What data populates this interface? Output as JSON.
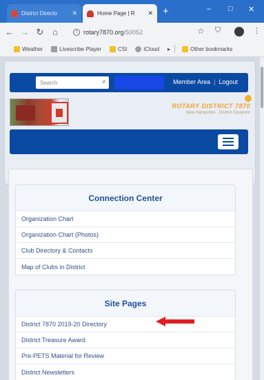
{
  "browser": {
    "tabs": [
      {
        "label": "District Directo",
        "active": false
      },
      {
        "label": "Home Page | R",
        "active": true
      }
    ],
    "new_tab_glyph": "+",
    "window": {
      "minimize": "–",
      "maximize": "□",
      "close": "✕"
    },
    "address": {
      "domain": "rotary7870.org",
      "path": "/50052"
    },
    "bookmarks": [
      {
        "label": "Weather",
        "icon": "folder"
      },
      {
        "label": "Livescribe Player",
        "icon": "app"
      },
      {
        "label": "CSI",
        "icon": "folder"
      },
      {
        "label": "iCloud",
        "icon": "apple"
      },
      {
        "label": "Other bookmarks",
        "icon": "folder"
      }
    ]
  },
  "site": {
    "search": {
      "placeholder": "Search"
    },
    "top_links": {
      "member_area": "Member Area",
      "logout": "Logout"
    },
    "brand": {
      "title": "ROTARY DISTRICT 7870",
      "subtitle": "New Hampshire · District Governor"
    },
    "accent_colors": {
      "primary": "#0b4aa3",
      "brand_orange": "#f2a030",
      "arrow_red": "#e02020"
    }
  },
  "sections": [
    {
      "title": "Connection Center",
      "items": [
        "Organization Chart",
        "Organization Chart (Photos)",
        "Club Directory & Contacts",
        "Map of Clubs in District"
      ]
    },
    {
      "title": "Site Pages",
      "items": [
        "District 7870 2019-20 Directory",
        "District Treasure Award",
        "Pre-PETS Material for Review",
        "District Newsletters"
      ]
    }
  ]
}
